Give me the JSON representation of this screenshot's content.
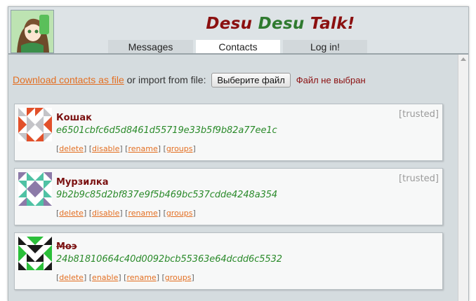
{
  "app": {
    "title_part1": "Desu ",
    "title_part2": "Desu",
    "title_part3": " Talk!"
  },
  "tabs": [
    {
      "label": "Messages",
      "active": false
    },
    {
      "label": "Contacts",
      "active": true
    },
    {
      "label": "Log in!",
      "active": false
    }
  ],
  "import_row": {
    "download_link": "Download contacts as file",
    "or_import_text": " or import from file:",
    "file_button": "Выберите файл",
    "no_file_text": "Файл не выбран"
  },
  "contacts": [
    {
      "name": "Кошак",
      "hash": "e6501cbfc6d5d8461d55719e33b5f9b82a77ee1c",
      "trust": "[trusted]",
      "disabled": false,
      "identicon_icon": "identicon-red-grey",
      "actions": [
        "delete",
        "disable",
        "rename",
        "groups"
      ]
    },
    {
      "name": "Мурзилка",
      "hash": "9b2b9c85d2bf837e9f5b469bc537cdde4248a354",
      "trust": "[trusted]",
      "disabled": false,
      "identicon_icon": "identicon-purple-teal",
      "actions": [
        "delete",
        "disable",
        "rename",
        "groups"
      ]
    },
    {
      "name": "Моэ",
      "hash": "24b81810664c40d0092bcb55363e64dcdd6c5532",
      "trust": "",
      "disabled": true,
      "identicon_icon": "identicon-green-black",
      "actions": [
        "delete",
        "enable",
        "rename",
        "groups"
      ]
    }
  ],
  "colors": {
    "title_red": "#8b1010",
    "title_green": "#2f7a2f",
    "link_orange": "#e36f22",
    "hash_green": "#2a8a2a",
    "contact_name": "#7a1010"
  }
}
